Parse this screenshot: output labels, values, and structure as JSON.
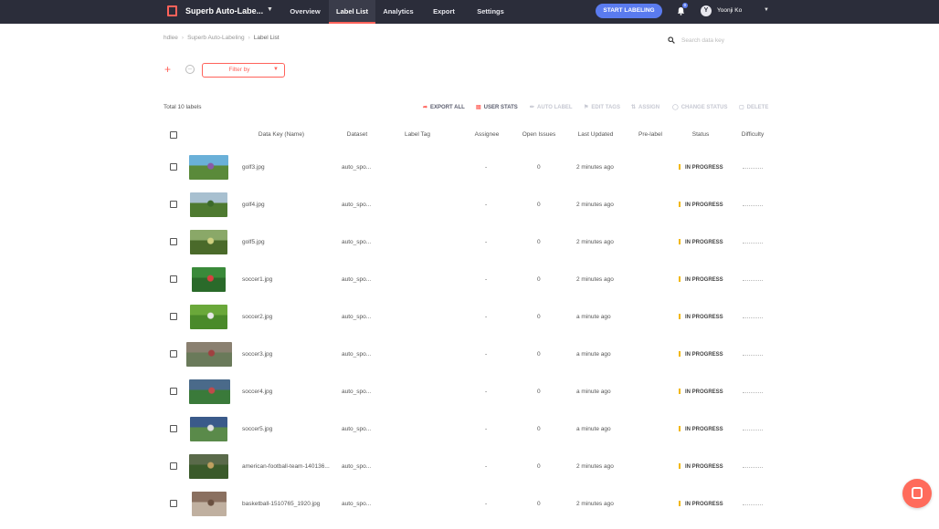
{
  "header": {
    "project_name": "Superb Auto-Labe...",
    "tabs": [
      {
        "label": "Overview",
        "active": false
      },
      {
        "label": "Label List",
        "active": true
      },
      {
        "label": "Analytics",
        "active": false
      },
      {
        "label": "Export",
        "active": false
      },
      {
        "label": "Settings",
        "active": false
      }
    ],
    "start_button": "START LABELING",
    "notification_count": "9",
    "user_initial": "Y",
    "user_name": "Yoonji Ko"
  },
  "breadcrumb": [
    "hdlee",
    "Superb Auto-Labeling",
    "Label List"
  ],
  "search": {
    "placeholder": "Search data key"
  },
  "filter": {
    "label": "Filter by"
  },
  "toolbar": {
    "total": "Total 10 labels",
    "actions": [
      {
        "label": "EXPORT ALL",
        "icon": "share-icon",
        "enabled": true
      },
      {
        "label": "USER STATS",
        "icon": "chart-icon",
        "enabled": true
      },
      {
        "label": "AUTO LABEL",
        "icon": "magic-wand-icon",
        "enabled": false
      },
      {
        "label": "EDIT TAGS",
        "icon": "tag-icon",
        "enabled": false
      },
      {
        "label": "ASSIGN",
        "icon": "assign-icon",
        "enabled": false
      },
      {
        "label": "CHANGE STATUS",
        "icon": "status-icon",
        "enabled": false
      },
      {
        "label": "DELETE",
        "icon": "trash-icon",
        "enabled": false
      }
    ]
  },
  "table": {
    "columns": [
      "Data Key (Name)",
      "Dataset",
      "Label Tag",
      "Assignee",
      "Open Issues",
      "Last Updated",
      "Pre-label",
      "Status",
      "Difficulty"
    ],
    "rows": [
      {
        "name": "golf3.jpg",
        "dataset": "auto_spo...",
        "assignee": "-",
        "issues": "0",
        "updated": "2 minutes ago",
        "status": "IN PROGRESS",
        "thumb_colors": [
          "#6ab0d8",
          "#5a8a3a",
          "#8a5aa8"
        ]
      },
      {
        "name": "golf4.jpg",
        "dataset": "auto_spo...",
        "assignee": "-",
        "issues": "0",
        "updated": "2 minutes ago",
        "status": "IN PROGRESS",
        "thumb_colors": [
          "#a8c0d0",
          "#4e7a30",
          "#3c6a2a"
        ]
      },
      {
        "name": "golf5.jpg",
        "dataset": "auto_spo...",
        "assignee": "-",
        "issues": "0",
        "updated": "2 minutes ago",
        "status": "IN PROGRESS",
        "thumb_colors": [
          "#8aa868",
          "#4a6a2a",
          "#cfd080"
        ]
      },
      {
        "name": "soccer1.jpg",
        "dataset": "auto_spo...",
        "assignee": "-",
        "issues": "0",
        "updated": "2 minutes ago",
        "status": "IN PROGRESS",
        "thumb_colors": [
          "#3a8a3a",
          "#2a6a2a",
          "#d84040"
        ]
      },
      {
        "name": "soccer2.jpg",
        "dataset": "auto_spo...",
        "assignee": "-",
        "issues": "0",
        "updated": "a minute ago",
        "status": "IN PROGRESS",
        "thumb_colors": [
          "#6aa83a",
          "#4a8a2a",
          "#e8e8e8"
        ]
      },
      {
        "name": "soccer3.jpg",
        "dataset": "auto_spo...",
        "assignee": "-",
        "issues": "0",
        "updated": "a minute ago",
        "status": "IN PROGRESS",
        "thumb_colors": [
          "#8a8070",
          "#6a7a5a",
          "#a04040"
        ]
      },
      {
        "name": "soccer4.jpg",
        "dataset": "auto_spo...",
        "assignee": "-",
        "issues": "0",
        "updated": "a minute ago",
        "status": "IN PROGRESS",
        "thumb_colors": [
          "#4a6a8a",
          "#3a7a3a",
          "#c04a4a"
        ]
      },
      {
        "name": "soccer5.jpg",
        "dataset": "auto_spo...",
        "assignee": "-",
        "issues": "0",
        "updated": "a minute ago",
        "status": "IN PROGRESS",
        "thumb_colors": [
          "#3a5a8a",
          "#5a8a4a",
          "#e0e0e0"
        ]
      },
      {
        "name": "american-football-team-140136...",
        "dataset": "auto_spo...",
        "assignee": "-",
        "issues": "0",
        "updated": "2 minutes ago",
        "status": "IN PROGRESS",
        "thumb_colors": [
          "#5a6a4a",
          "#3a5a2a",
          "#c0a060"
        ]
      },
      {
        "name": "basketball-1510765_1920.jpg",
        "dataset": "auto_spo...",
        "assignee": "-",
        "issues": "0",
        "updated": "2 minutes ago",
        "status": "IN PROGRESS",
        "thumb_colors": [
          "#8a7060",
          "#c0b0a0",
          "#6a5040"
        ]
      }
    ]
  }
}
